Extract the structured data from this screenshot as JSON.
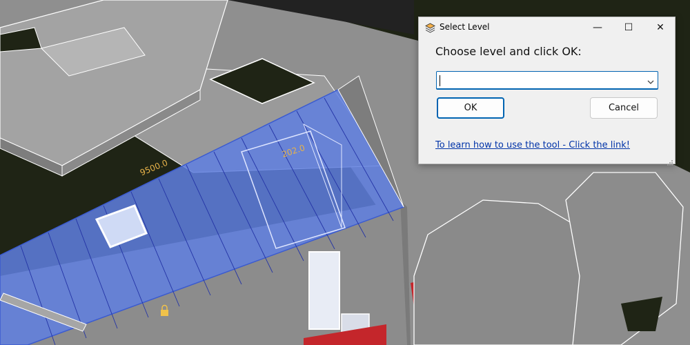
{
  "dialog": {
    "title": "Select Level",
    "prompt": "Choose level and click OK:",
    "level_select": {
      "value": ""
    },
    "ok_label": "OK",
    "cancel_label": "Cancel",
    "help_link": "To learn how to use the tool - Click the link!",
    "window_controls": {
      "minimize": "—",
      "maximize": "☐",
      "close": "✕"
    }
  },
  "viewport": {
    "dimension_1": "9500.0",
    "dimension_2": "202.0"
  }
}
